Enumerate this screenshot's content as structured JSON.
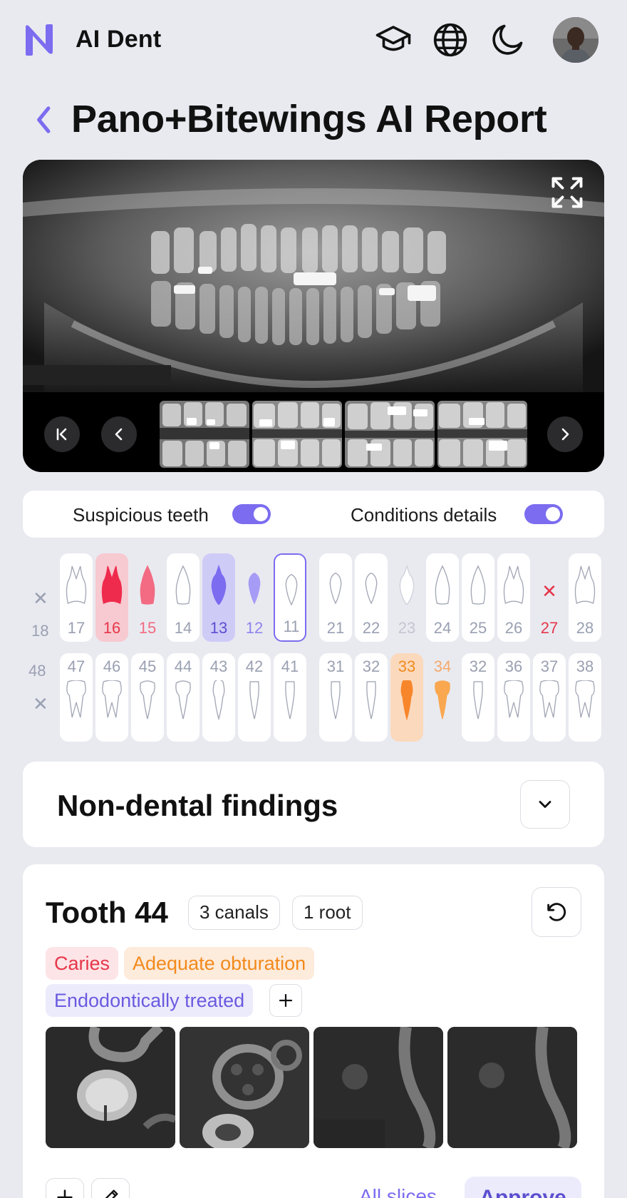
{
  "app": {
    "name": "AI Dent"
  },
  "header": {
    "icons": [
      "graduation-cap-icon",
      "globe-icon",
      "moon-icon"
    ]
  },
  "page": {
    "title": "Pano+Bitewings AI Report"
  },
  "toggles": {
    "suspicious": {
      "label": "Suspicious teeth",
      "on": true
    },
    "conditions": {
      "label": "Conditions details",
      "on": true
    }
  },
  "chart": {
    "upper_missing": "18",
    "lower_missing": "48",
    "upper": [
      {
        "num": "17",
        "state": "normal",
        "shape": "molar"
      },
      {
        "num": "16",
        "state": "red-filled",
        "shape": "molar"
      },
      {
        "num": "15",
        "state": "red",
        "shape": "premolar"
      },
      {
        "num": "14",
        "state": "normal",
        "shape": "premolar"
      },
      {
        "num": "13",
        "state": "purple-filled",
        "shape": "canine"
      },
      {
        "num": "12",
        "state": "purple",
        "shape": "incisor"
      },
      {
        "num": "11",
        "state": "selected",
        "shape": "incisor"
      },
      {
        "num": "21",
        "state": "normal",
        "shape": "incisor"
      },
      {
        "num": "22",
        "state": "normal",
        "shape": "incisor"
      },
      {
        "num": "23",
        "state": "faded",
        "shape": "canine"
      },
      {
        "num": "24",
        "state": "normal",
        "shape": "premolar"
      },
      {
        "num": "25",
        "state": "normal",
        "shape": "premolar"
      },
      {
        "num": "26",
        "state": "normal",
        "shape": "molar"
      },
      {
        "num": "27",
        "state": "missing-red",
        "shape": "none"
      },
      {
        "num": "28",
        "state": "normal",
        "shape": "molar"
      }
    ],
    "lower": [
      {
        "num": "47",
        "state": "normal",
        "shape": "molar"
      },
      {
        "num": "46",
        "state": "normal",
        "shape": "molar"
      },
      {
        "num": "45",
        "state": "normal",
        "shape": "premolar"
      },
      {
        "num": "44",
        "state": "normal",
        "shape": "premolar"
      },
      {
        "num": "43",
        "state": "normal",
        "shape": "canine"
      },
      {
        "num": "42",
        "state": "normal",
        "shape": "incisor"
      },
      {
        "num": "41",
        "state": "normal",
        "shape": "incisor"
      },
      {
        "num": "31",
        "state": "normal",
        "shape": "incisor"
      },
      {
        "num": "32",
        "state": "normal",
        "shape": "incisor"
      },
      {
        "num": "33",
        "state": "orange-filled",
        "shape": "canine"
      },
      {
        "num": "34",
        "state": "orange",
        "shape": "premolar"
      },
      {
        "num": "32",
        "state": "normal",
        "shape": "incisor"
      },
      {
        "num": "36",
        "state": "normal",
        "shape": "molar"
      },
      {
        "num": "37",
        "state": "normal",
        "shape": "molar"
      },
      {
        "num": "38",
        "state": "normal",
        "shape": "molar"
      }
    ]
  },
  "nondental": {
    "title": "Non-dental findings"
  },
  "tooth_card": {
    "title": "Tooth 44",
    "canals": "3 canals",
    "roots": "1 root",
    "tags": {
      "caries": "Caries",
      "obturation": "Adequate obturation",
      "endo": "Endodontically treated"
    },
    "all_slices": "All slices",
    "approve": "Approve"
  },
  "colors": {
    "accent": "#7b6cf0",
    "red": "#e6364a",
    "orange": "#f28a1d",
    "purple": "#6a5ae0"
  }
}
